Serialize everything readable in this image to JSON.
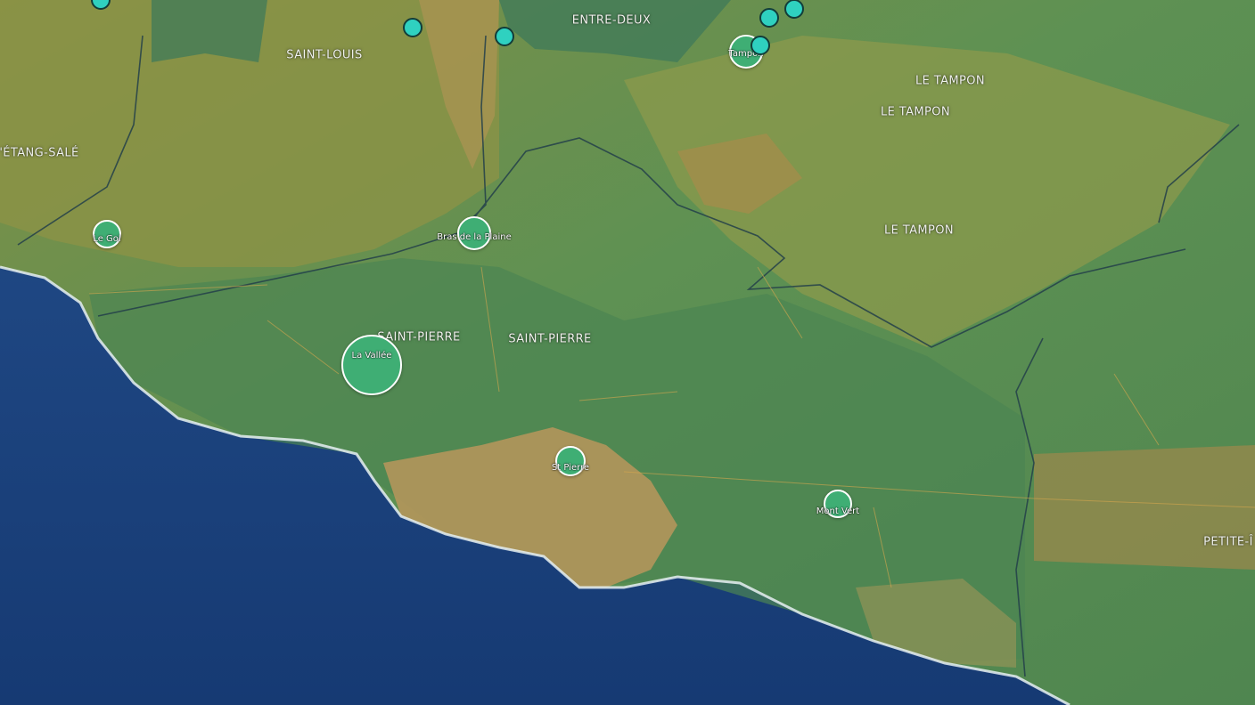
{
  "colors": {
    "ocean": "#1e4a88",
    "ocean_deep": "#163c78",
    "land_green": "#4e8a55",
    "land_olive": "#8c9c4a",
    "land_orange": "#a98e4a",
    "urban": "#b99a5e",
    "surf": "#e8f2f4",
    "cluster_fill": "#3fae74",
    "station_fill": "#2fd1c0",
    "boundary": "#23404a"
  },
  "commune_labels": [
    {
      "id": "saint-louis",
      "text": "SAINT-LOUIS"
    },
    {
      "id": "entre-deux",
      "text": "ENTRE-DEUX"
    },
    {
      "id": "etang-sale",
      "text": "'ÉTANG-SALÉ"
    },
    {
      "id": "le-tampon-1",
      "text": "LE TAMPON"
    },
    {
      "id": "le-tampon-2",
      "text": "LE TAMPON"
    },
    {
      "id": "le-tampon-3",
      "text": "LE TAMPON"
    },
    {
      "id": "saint-pierre-1",
      "text": "SAINT-PIERRE"
    },
    {
      "id": "saint-pierre-2",
      "text": "SAINT-PIERRE"
    },
    {
      "id": "petite-ile",
      "text": "PETITE-Î"
    }
  ],
  "markers": [
    {
      "id": "le-gol",
      "label": "Le Gol"
    },
    {
      "id": "bras-de-la-plaine",
      "label": "Bras de la Plaine"
    },
    {
      "id": "la-vallee",
      "label": "La Vallée"
    },
    {
      "id": "st-pierre",
      "label": "St Pierre"
    },
    {
      "id": "mont-vert",
      "label": "Mont Vert"
    },
    {
      "id": "tampon",
      "label": "Tampon"
    }
  ],
  "stations": [
    {
      "id": "s1"
    },
    {
      "id": "s2"
    },
    {
      "id": "s3"
    },
    {
      "id": "s4"
    },
    {
      "id": "s5"
    },
    {
      "id": "s6"
    }
  ]
}
